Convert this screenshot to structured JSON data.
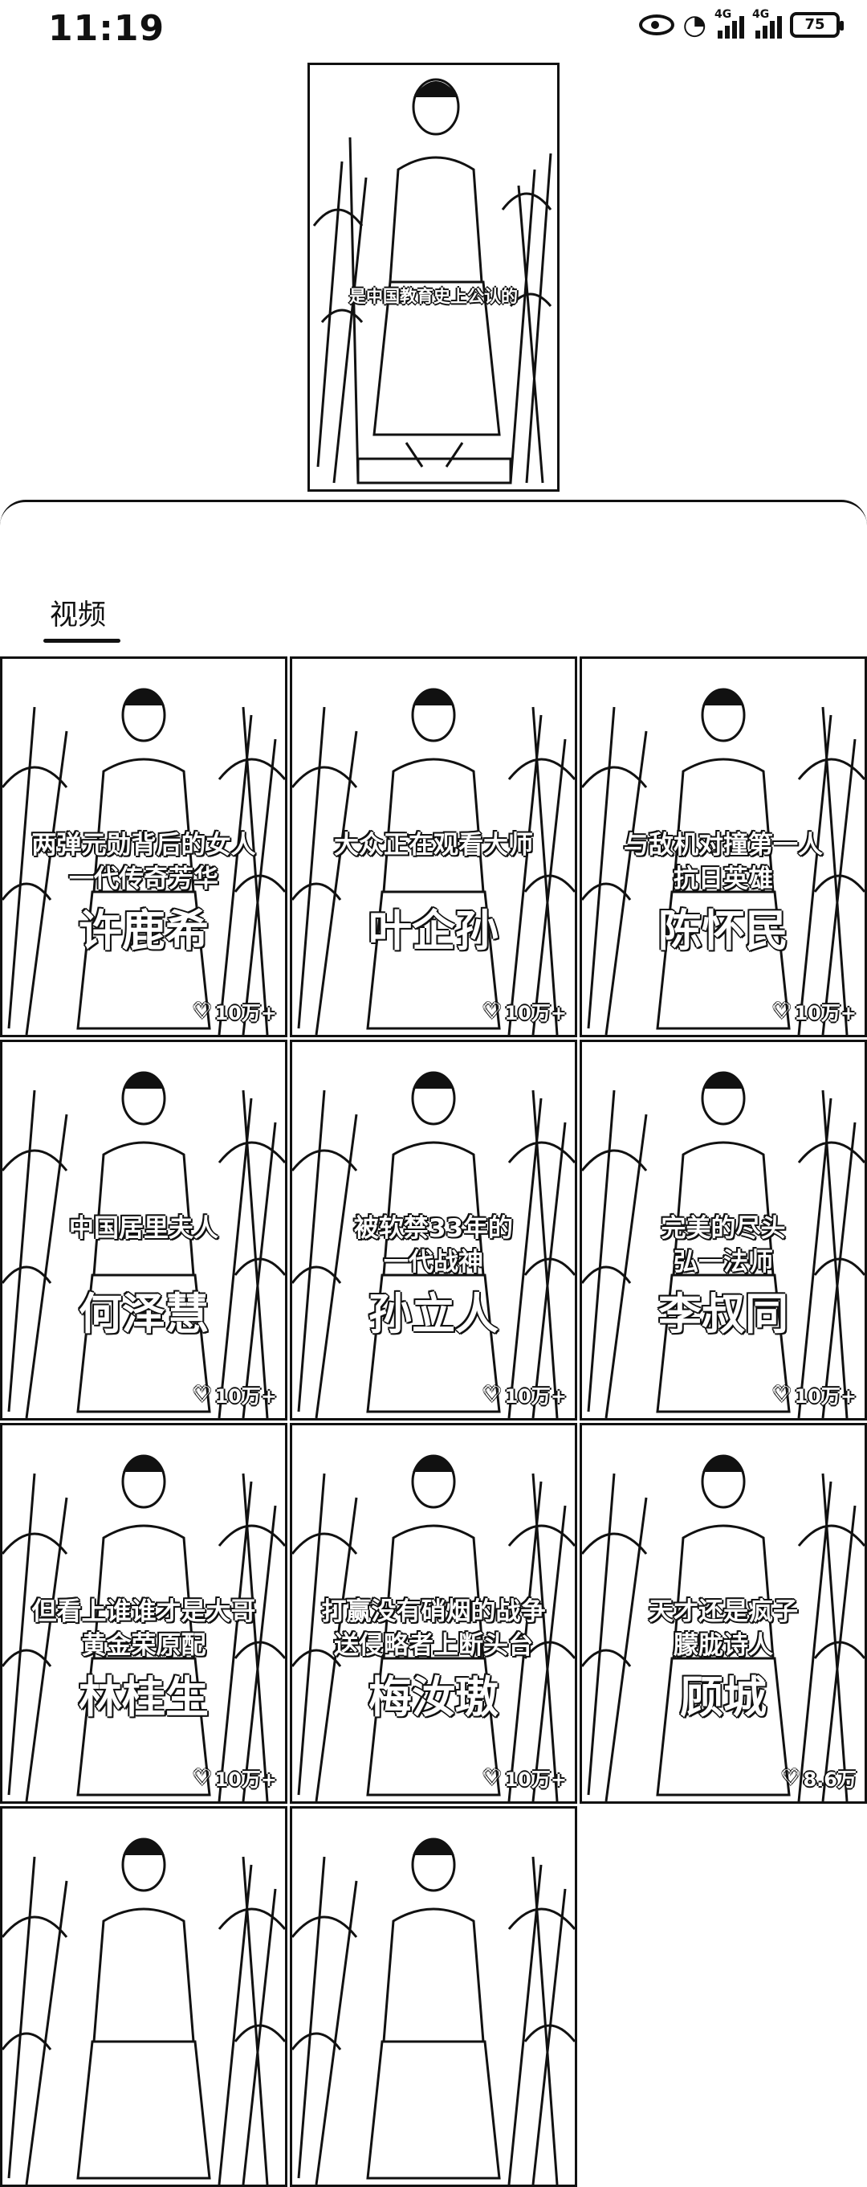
{
  "status": {
    "time": "11:19",
    "network_a": "4G",
    "network_b": "4G",
    "battery": "75"
  },
  "main_video": {
    "caption": "是中国教育史上公认的"
  },
  "tabs": [
    {
      "label": "视频",
      "active": true
    }
  ],
  "videos": [
    {
      "lines": [
        "两弹元勋背后的女人",
        "一代传奇芳华",
        "许鹿希"
      ],
      "likes": "10万+"
    },
    {
      "lines": [
        "大众正在观看大师",
        "",
        "叶企孙"
      ],
      "likes": "10万+"
    },
    {
      "lines": [
        "与敌机对撞第一人",
        "抗日英雄",
        "陈怀民"
      ],
      "likes": "10万+"
    },
    {
      "lines": [
        "中国居里夫人",
        "",
        "何泽慧"
      ],
      "likes": "10万+"
    },
    {
      "lines": [
        "被软禁33年的",
        "一代战神",
        "孙立人"
      ],
      "likes": "10万+"
    },
    {
      "lines": [
        "完美的尽头",
        "弘一法师",
        "李叔同"
      ],
      "likes": "10万+"
    },
    {
      "lines": [
        "但看上谁谁才是大哥",
        "黄金荣原配",
        "林桂生"
      ],
      "likes": "10万+"
    },
    {
      "lines": [
        "打赢没有硝烟的战争",
        "送侵略者上断头台",
        "梅汝璈"
      ],
      "likes": "10万+"
    },
    {
      "lines": [
        "天才还是疯子",
        "朦胧诗人",
        "顾城"
      ],
      "likes": "8.6万"
    },
    {
      "lines": [
        "",
        "",
        ""
      ],
      "likes": ""
    },
    {
      "lines": [
        "",
        "",
        ""
      ],
      "likes": ""
    }
  ]
}
